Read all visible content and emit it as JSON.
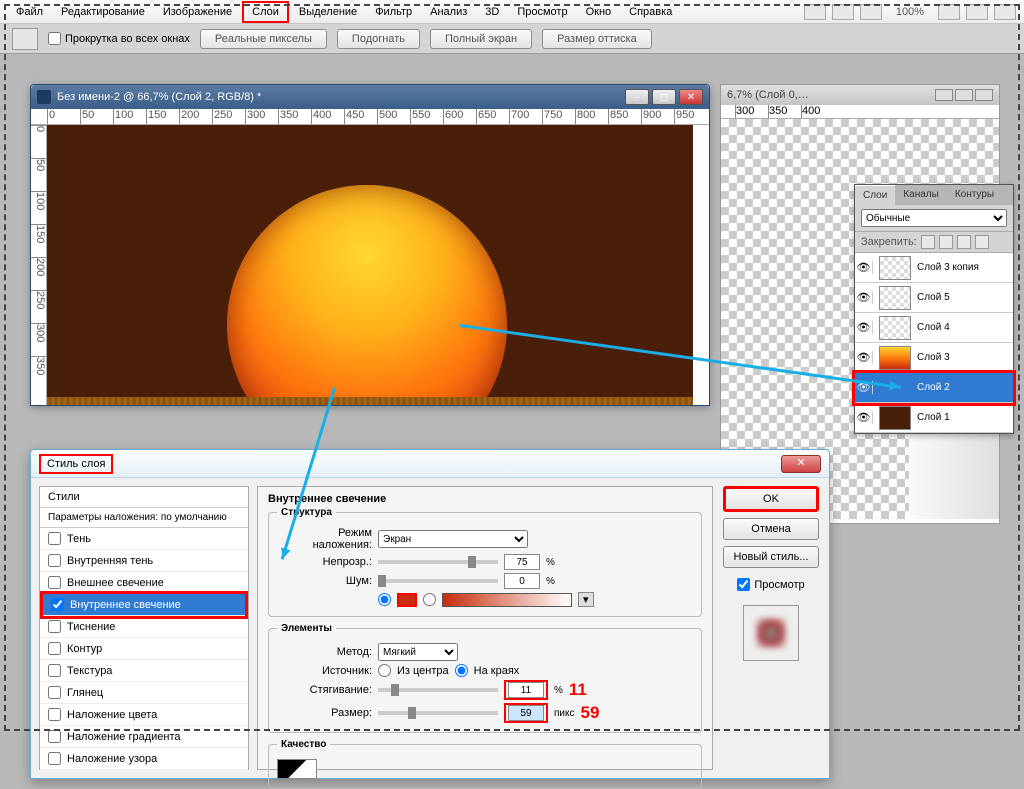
{
  "menu": {
    "items": [
      "Файл",
      "Редактирование",
      "Изображение",
      "Слои",
      "Выделение",
      "Фильтр",
      "Анализ",
      "3D",
      "Просмотр",
      "Окно",
      "Справка"
    ],
    "highlight_index": 3,
    "zoom": "100%"
  },
  "optbar": {
    "scroll_all": "Прокрутка во всех окнах",
    "buttons": [
      "Реальные пикселы",
      "Подогнать",
      "Полный экран",
      "Размер оттиска"
    ]
  },
  "doc": {
    "title": "Без имени-2 @ 66,7% (Слой 2, RGB/8) *",
    "ruler_h": [
      "0",
      "50",
      "100",
      "150",
      "200",
      "250",
      "300",
      "350",
      "400",
      "450",
      "500",
      "550",
      "600",
      "650",
      "700",
      "750",
      "800",
      "850",
      "900",
      "950"
    ],
    "ruler_v": [
      "0",
      "50",
      "100",
      "150",
      "200",
      "250",
      "300",
      "350"
    ]
  },
  "doc2": {
    "title": "6,7% (Слой 0,…",
    "ruler": [
      "300",
      "350",
      "400"
    ]
  },
  "layers_panel": {
    "tabs": [
      "Слои",
      "Каналы",
      "Контуры"
    ],
    "blend_label": "Обычные",
    "lock_label": "Закрепить:",
    "items": [
      {
        "name": "Слой 3 копия",
        "thumb": "plain"
      },
      {
        "name": "Слой 5",
        "thumb": "plain"
      },
      {
        "name": "Слой 4",
        "thumb": "plain"
      },
      {
        "name": "Слой 3",
        "thumb": "grad"
      },
      {
        "name": "Слой 2",
        "thumb": "sun"
      },
      {
        "name": "Слой 1",
        "thumb": "brown"
      }
    ],
    "selected_index": 4
  },
  "dialog": {
    "title": "Стиль слоя",
    "styles_header": "Стили",
    "blend_defaults": "Параметры наложения: по умолчанию",
    "effects": [
      "Тень",
      "Внутренняя тень",
      "Внешнее свечение",
      "Внутреннее свечение",
      "Тиснение",
      "Контур",
      "Текстура",
      "Глянец",
      "Наложение цвета",
      "Наложение градиента",
      "Наложение узора"
    ],
    "selected_effect_index": 3,
    "section_title": "Внутреннее свечение",
    "structure": {
      "legend": "Структура",
      "blend_mode_label": "Режим наложения:",
      "blend_mode": "Экран",
      "opacity_label": "Непрозр.:",
      "opacity": "75",
      "opacity_unit": "%",
      "noise_label": "Шум:",
      "noise": "0",
      "noise_unit": "%",
      "color_hex": "#c62e0c"
    },
    "elements": {
      "legend": "Элементы",
      "method_label": "Метод:",
      "method": "Мягкий",
      "source_label": "Источник:",
      "source_center": "Из центра",
      "source_edge": "На краях",
      "choke_label": "Стягивание:",
      "choke": "11",
      "choke_unit": "%",
      "size_label": "Размер:",
      "size": "59",
      "size_unit": "пикс"
    },
    "quality_legend": "Качество",
    "annot_choke": "11",
    "annot_size": "59",
    "buttons": {
      "ok": "OK",
      "cancel": "Отмена",
      "new_style": "Новый стиль..."
    },
    "preview_label": "Просмотр"
  }
}
